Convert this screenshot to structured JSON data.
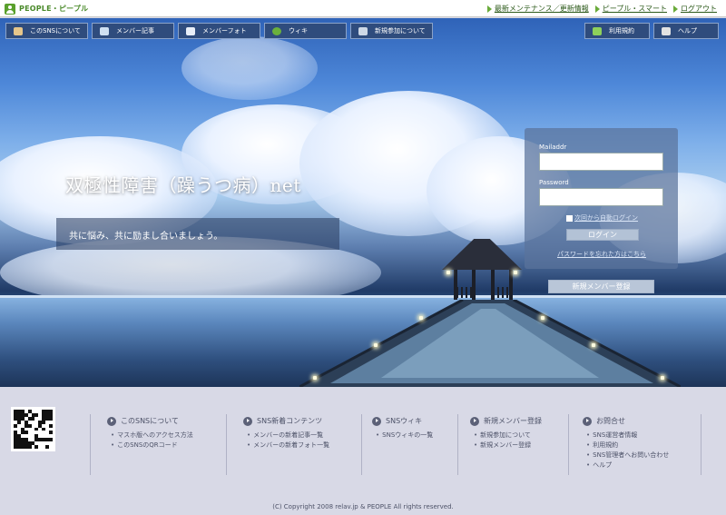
{
  "brand": {
    "name": "PEOPLE・ピープル"
  },
  "top_links": [
    {
      "label": "最新メンテナンス／更新情報"
    },
    {
      "label": "ピープル・スマート"
    },
    {
      "label": "ログアウト"
    }
  ],
  "nav_left": [
    {
      "label": "このSNSについて",
      "icon": "user-icon"
    },
    {
      "label": "メンバー記事",
      "icon": "pen-icon"
    },
    {
      "label": "メンバーフォト",
      "icon": "photo-icon"
    },
    {
      "label": "ウィキ",
      "icon": "globe-icon"
    },
    {
      "label": "新規参加について",
      "icon": "group-icon"
    }
  ],
  "nav_right": [
    {
      "label": "利用規約",
      "icon": "leaf-icon"
    },
    {
      "label": "ヘルプ",
      "icon": "tools-icon"
    }
  ],
  "hero": {
    "title": "双極性障害（躁うつ病）net",
    "tagline": "共に悩み、共に励まし合いましょう。"
  },
  "login": {
    "mail_label": "Mailaddr",
    "mail_value": "",
    "password_label": "Password",
    "password_value": "",
    "remember_label": "次回から自動ログイン",
    "login_button": "ログイン",
    "forgot_link": "パスワードを忘れた方はこちら",
    "register_button": "新規メンバー登録"
  },
  "footer": {
    "columns": [
      {
        "heading": "このSNSについて",
        "items": [
          "マスホ版へのアクセス方法",
          "このSNSのQRコード"
        ]
      },
      {
        "heading": "SNS新着コンテンツ",
        "items": [
          "メンバーの新着記事一覧",
          "メンバーの新着フォト一覧"
        ]
      },
      {
        "heading": "SNSウィキ",
        "items": [
          "SNSウィキの一覧"
        ]
      },
      {
        "heading": "新規メンバー登録",
        "items": [
          "新規参加について",
          "新規メンバー登録"
        ]
      },
      {
        "heading": "お問合せ",
        "items": [
          "SNS運営者情報",
          "利用規約",
          "SNS管理者へお問い合わせ",
          "ヘルプ"
        ]
      }
    ],
    "copyright": "(C) Copyright 2008 relav.jp & PEOPLE All rights reserved."
  },
  "colors": {
    "accent_green": "#5aa02c",
    "nav_bg": "#2f4c7d",
    "footer_bg": "#d8d9e6"
  }
}
